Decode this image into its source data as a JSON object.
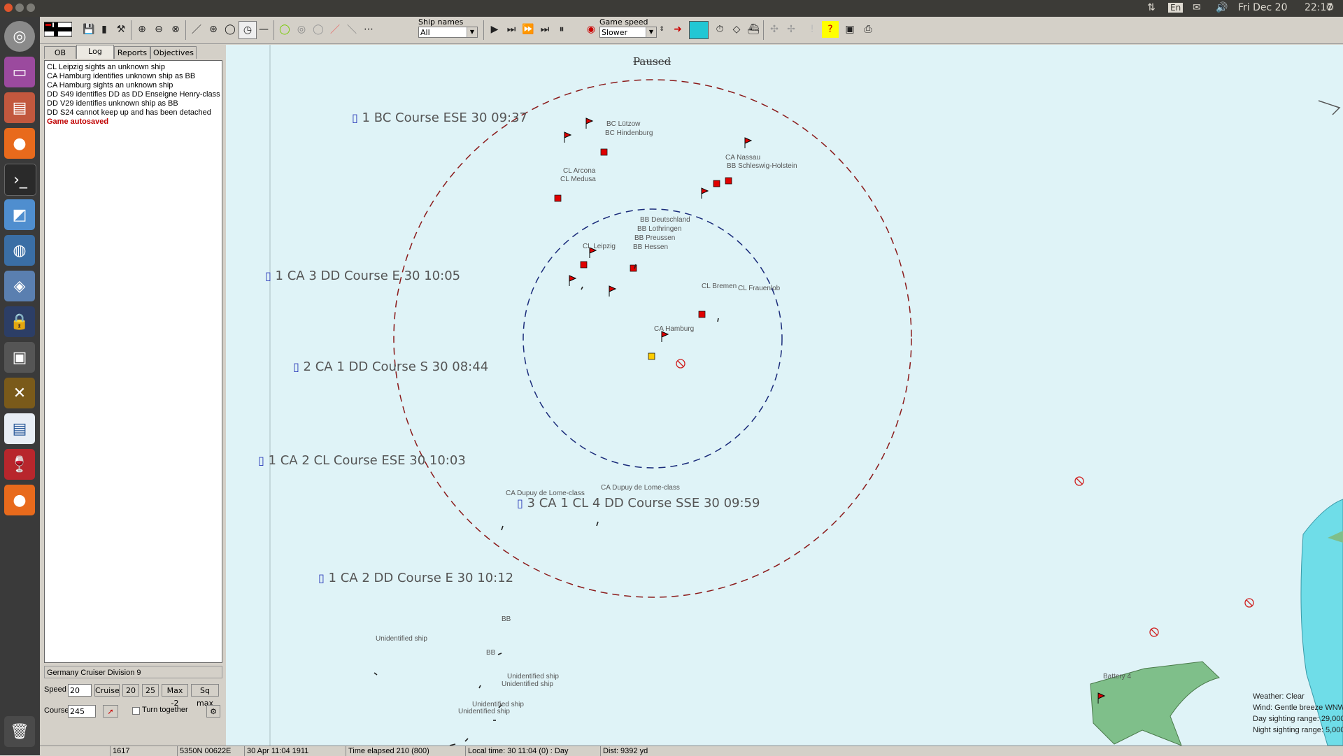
{
  "topbar": {
    "lang": "En",
    "date": "Fri Dec 20",
    "time": "22:17"
  },
  "toolbar": {
    "ship_names_label": "Ship names",
    "ship_names_value": "All",
    "game_speed_label": "Game speed",
    "game_speed_value": "Slower"
  },
  "left_panel": {
    "tabs": [
      "OB",
      "Log",
      "Reports",
      "Objectives"
    ],
    "active_tab": "Log",
    "log": [
      "CL Leipzig sights an unknown ship",
      "CA Hamburg identifies unknown ship as BB",
      "CA Hamburg sights an unknown ship",
      "DD S49 identifies DD as DD Enseigne Henry-class",
      "DD V29 identifies unknown ship as BB",
      "DD S24 cannot keep up and has been detached"
    ],
    "log_highlight": "Game autosaved",
    "division_name": "Germany Cruiser Division 9",
    "speed_label": "Speed",
    "speed_value": "20",
    "speed_buttons": [
      "Cruise",
      "20",
      "25",
      "Max -2",
      "Sq max"
    ],
    "course_label": "Course",
    "course_value": "245",
    "turn_together_label": "Turn together"
  },
  "map": {
    "paused_label": "Paused",
    "contacts": [
      "1 BC Course ESE 30 09:37",
      "1 CA 3 DD Course E 30 10:05",
      "2 CA 1 DD Course S 30 08:44",
      "1 CA 2 CL Course ESE 30 10:03",
      "3 CA 1 CL 4 DD Course SSE 30 09:59",
      "1 CA 2 DD Course E 30 10:12"
    ],
    "ship_labels": [
      "BC Lützow",
      "BC Hindenburg",
      "CL Arcona",
      "CL Medusa",
      "CA Nassau",
      "BB Schleswig-Holstein",
      "BB Deutschland",
      "BB Lothringen",
      "BB Preussen",
      "BB Hessen",
      "CL Leipzig",
      "CL Bremen",
      "CL Frauenlob",
      "CA Hamburg",
      "CA Dupuy de Lome-class",
      "CA Dupuy de Lome-class",
      "BB",
      "BB",
      "Unidentified ship",
      "Unidentified ship",
      "Unidentified ship",
      "Unidentified ship",
      "Unidentified ship",
      "Battery 4"
    ],
    "weather": {
      "weather": "Weather: Clear",
      "wind": "Wind: Gentle breeze  WNW",
      "day_range": "Day sighting range: 29,000 yds",
      "night_range": "Night sighting range: 5,000 yds"
    }
  },
  "status_bar": {
    "year": "1617",
    "position": "5350N 00622E",
    "date": "30 Apr 11:04 1911",
    "elapsed": "Time elapsed 210 (800)",
    "local_time": "Local time: 30 11:04 (0) : Day",
    "dist": "Dist: 9392 yd"
  },
  "colors": {
    "sea": "#dff3f7",
    "land": "#7fbf8a",
    "shallow": "#6fdde8",
    "outer_ring": "#8b1a1a",
    "inner_ring": "#1a2b7a",
    "flag": "#e00000"
  }
}
